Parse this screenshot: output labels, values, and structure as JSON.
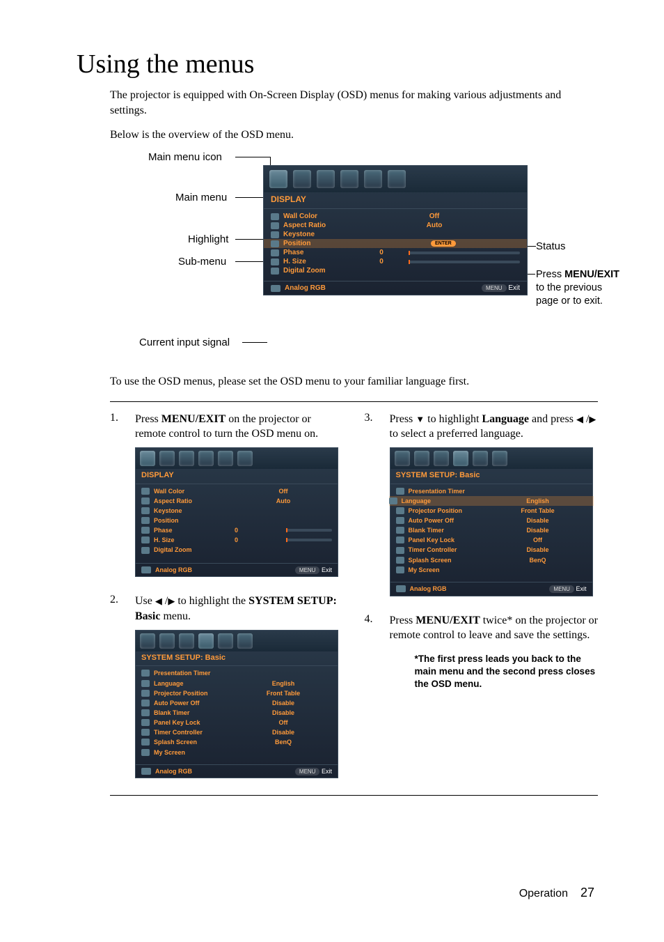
{
  "heading": "Using the menus",
  "intro": {
    "p1": "The projector is equipped with On-Screen Display (OSD) menus for making various adjustments and settings.",
    "p2": "Below is the overview of the OSD menu."
  },
  "labels": {
    "main_menu_icon": "Main menu icon",
    "main_menu": "Main menu",
    "highlight": "Highlight",
    "sub_menu": "Sub-menu",
    "current_input": "Current input signal",
    "status": "Status",
    "press_menu_exit": "Press MENU/EXIT to the previous page or to exit."
  },
  "osd_main": {
    "title": "DISPLAY",
    "rows": [
      {
        "label": "Wall Color",
        "value": "Off"
      },
      {
        "label": "Aspect Ratio",
        "value": "Auto"
      },
      {
        "label": "Keystone",
        "value": ""
      },
      {
        "label": "Position",
        "value": "",
        "enter": "ENTER",
        "hl": true
      },
      {
        "label": "Phase",
        "value": "0",
        "slider": true
      },
      {
        "label": "H. Size",
        "value": "0",
        "slider": true
      },
      {
        "label": "Digital Zoom",
        "value": ""
      }
    ],
    "footer_left": "Analog RGB",
    "footer_menu": "MENU",
    "footer_exit": "Exit"
  },
  "post": "To use the OSD menus, please set the OSD menu to your familiar language first.",
  "step1": {
    "n": "1.",
    "text_a": "Press ",
    "text_b": "MENU/EXIT",
    "text_c": " on the projector or remote control to turn the OSD menu on."
  },
  "step2": {
    "n": "2.",
    "text_a": "Use ",
    "text_b": " to highlight the ",
    "text_c": "SYSTEM SETUP: Basic",
    "text_d": " menu."
  },
  "step3": {
    "n": "3.",
    "text_a": "Press ",
    "text_b": " to highlight ",
    "text_c": "Language",
    "text_d": " and press ",
    "text_e": " to select a preferred language."
  },
  "step4": {
    "n": "4.",
    "text_a": "Press ",
    "text_b": "MENU/EXIT",
    "text_c": " twice* on the projector or remote control to leave and save the settings."
  },
  "note": "*The first press leads you back to the main menu and the second press closes the OSD menu.",
  "osd_sys": {
    "title": "SYSTEM SETUP: Basic",
    "rows": [
      {
        "label": "Presentation Timer",
        "value": ""
      },
      {
        "label": "Language",
        "value": "English"
      },
      {
        "label": "Projector Position",
        "value": "Front Table"
      },
      {
        "label": "Auto Power Off",
        "value": "Disable"
      },
      {
        "label": "Blank Timer",
        "value": "Disable"
      },
      {
        "label": "Panel Key Lock",
        "value": "Off"
      },
      {
        "label": "Timer Controller",
        "value": "Disable"
      },
      {
        "label": "Splash Screen",
        "value": "BenQ"
      },
      {
        "label": "My Screen",
        "value": ""
      }
    ],
    "footer_left": "Analog RGB",
    "footer_menu": "MENU",
    "footer_exit": "Exit"
  },
  "footer": {
    "section": "Operation",
    "page": "27"
  }
}
